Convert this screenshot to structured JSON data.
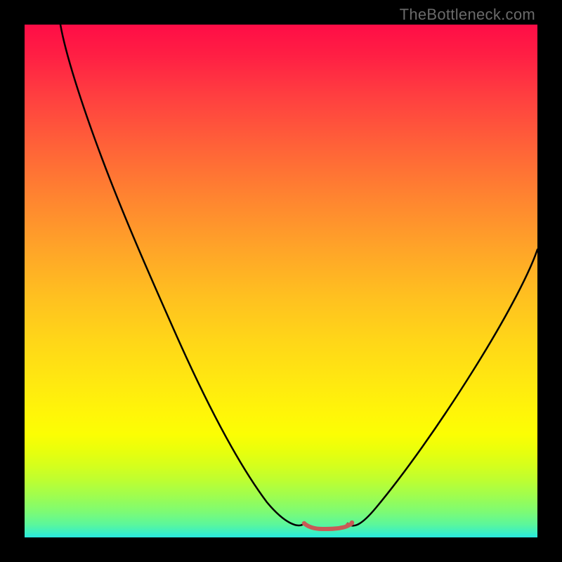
{
  "watermark": "TheBottleneck.com",
  "chart_data": {
    "type": "line",
    "title": "",
    "xlabel": "",
    "ylabel": "",
    "xlim": [
      0,
      100
    ],
    "ylim": [
      0,
      100
    ],
    "grid": false,
    "background": "red-yellow-green vertical gradient",
    "series": [
      {
        "name": "bottleneck-curve",
        "color": "#000000",
        "x": [
          7,
          12,
          18,
          24,
          30,
          36,
          42,
          48,
          52,
          54.5,
          56,
          58,
          61,
          63,
          65,
          70,
          76,
          83,
          90,
          97,
          100
        ],
        "y": [
          100,
          89,
          76,
          63,
          51,
          39,
          28,
          17,
          9,
          4,
          3,
          3,
          3,
          4,
          7,
          15,
          25,
          36,
          48,
          60,
          65
        ]
      },
      {
        "name": "valley-marker",
        "color": "#c95a56",
        "valley_x_range": [
          54.5,
          63
        ],
        "valley_y": 3
      }
    ]
  }
}
